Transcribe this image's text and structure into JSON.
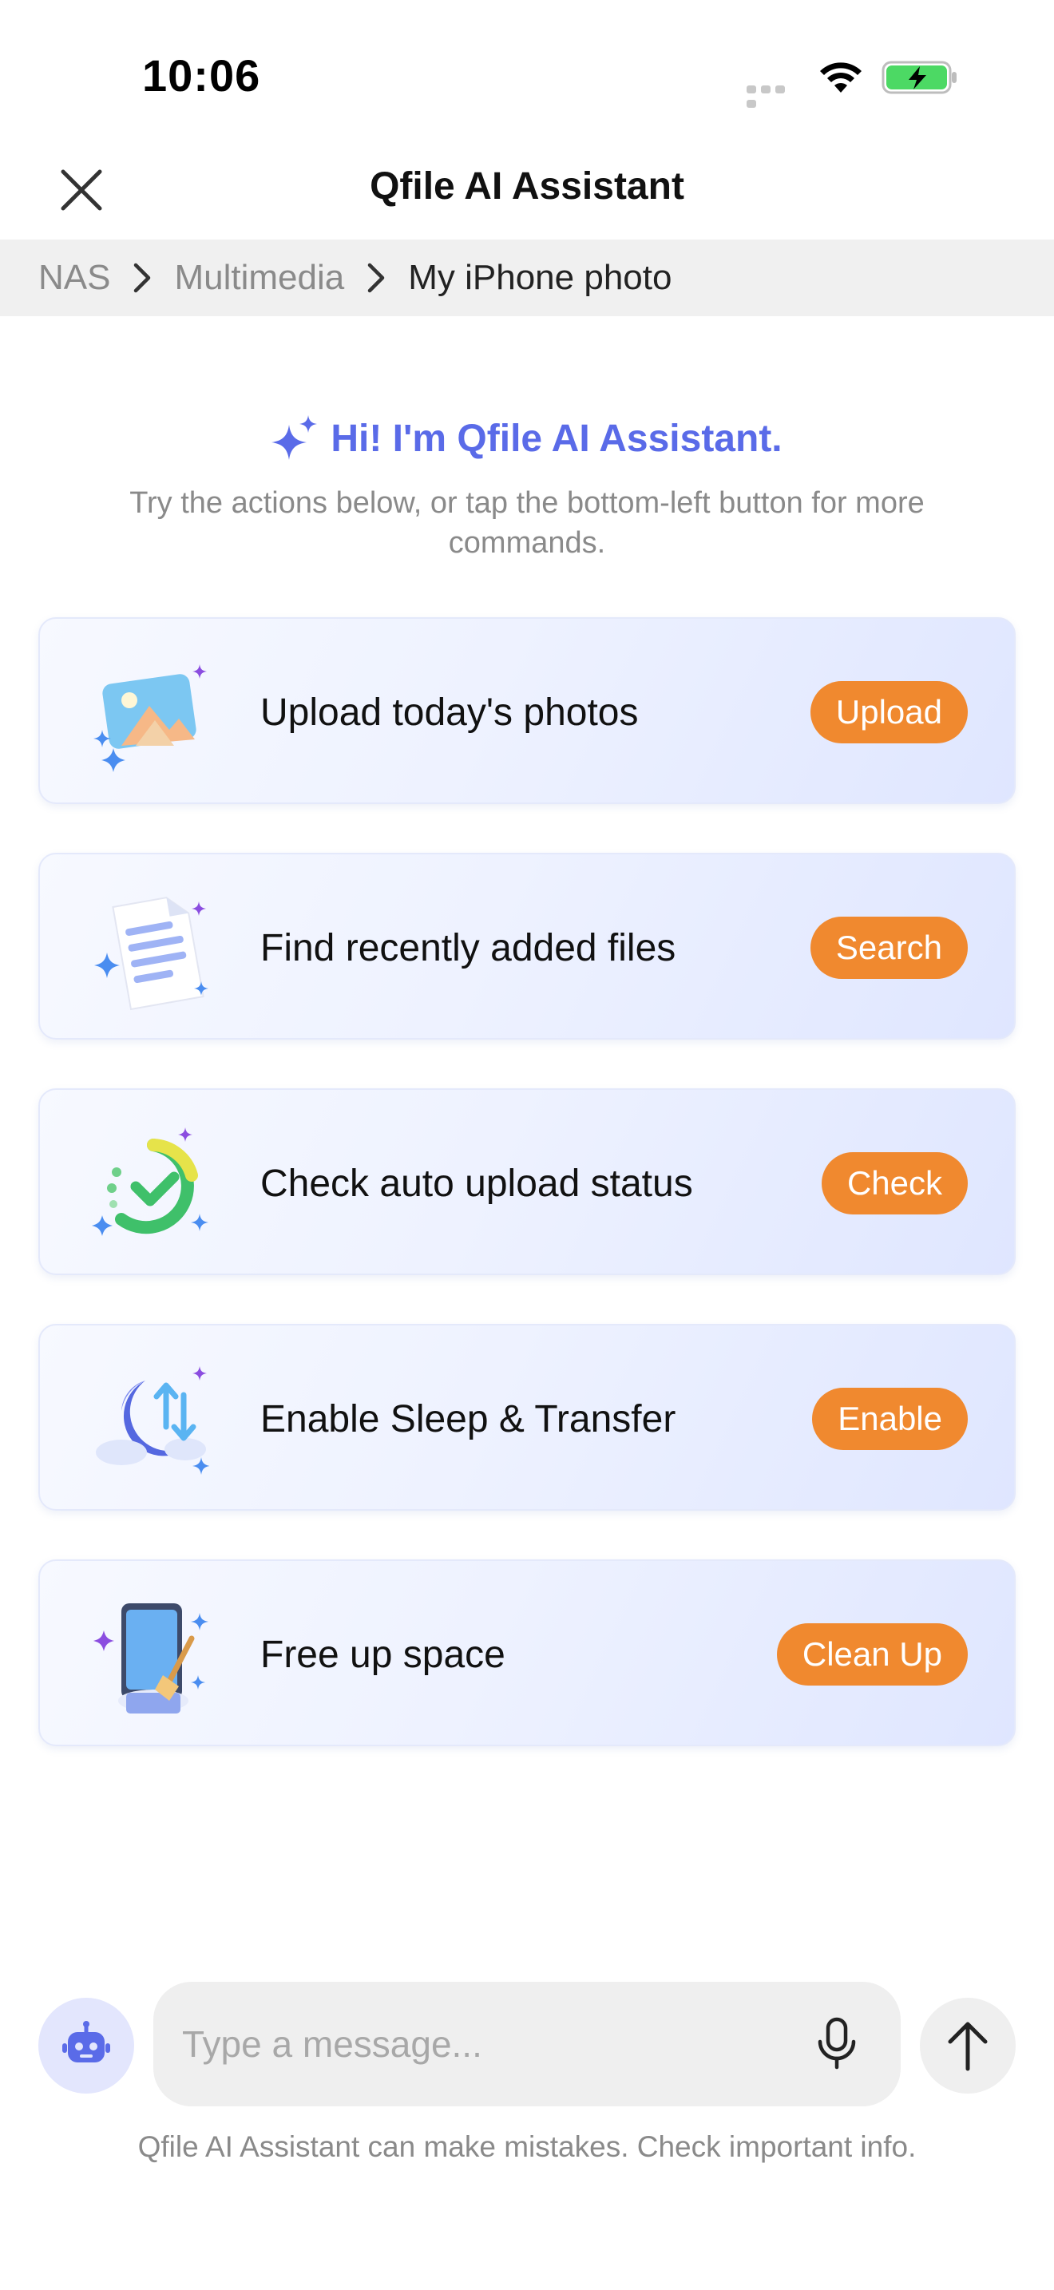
{
  "status_bar": {
    "time": "10:06"
  },
  "header": {
    "title": "Qfile AI Assistant"
  },
  "breadcrumb": [
    {
      "label": "NAS"
    },
    {
      "label": "Multimedia"
    },
    {
      "label": "My iPhone photo"
    }
  ],
  "greeting": {
    "title": "Hi! I'm Qfile AI Assistant.",
    "subtitle": "Try the actions below, or tap the bottom-left button for more commands."
  },
  "actions": [
    {
      "label": "Upload today's photos",
      "button": "Upload",
      "icon": "photo-upload-icon"
    },
    {
      "label": "Find recently added files",
      "button": "Search",
      "icon": "document-icon"
    },
    {
      "label": "Check auto upload status",
      "button": "Check",
      "icon": "progress-check-icon"
    },
    {
      "label": "Enable Sleep & Transfer",
      "button": "Enable",
      "icon": "moon-transfer-icon"
    },
    {
      "label": "Free up space",
      "button": "Clean Up",
      "icon": "phone-broom-icon"
    }
  ],
  "composer": {
    "placeholder": "Type a message...",
    "disclaimer": "Qfile AI Assistant can make mistakes. Check important info."
  },
  "colors": {
    "accent": "#5a6be8",
    "action_button": "#f0892f",
    "battery": "#4cd964"
  }
}
